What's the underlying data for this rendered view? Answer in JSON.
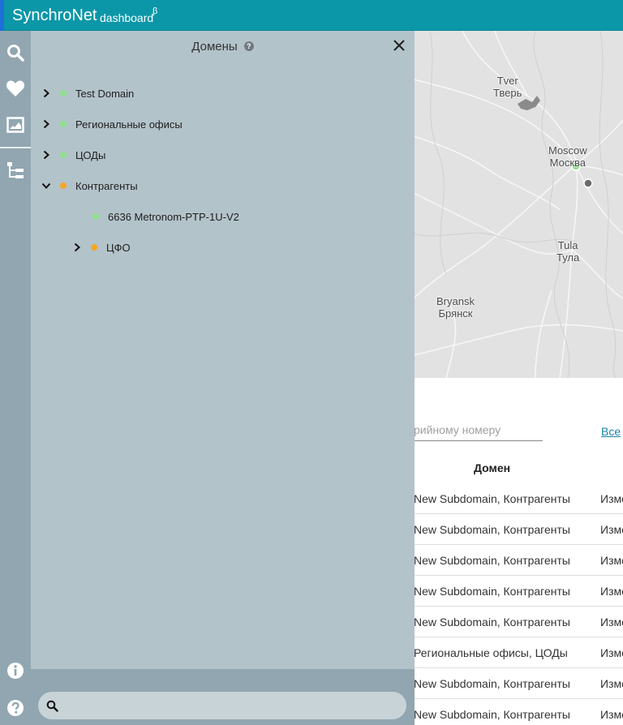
{
  "header": {
    "brand": "SynchroNet",
    "subtitle": "dashboard",
    "beta": "β"
  },
  "sidebar": {
    "icons": [
      "search-icon",
      "heart-icon",
      "map-frame-icon",
      "hierarchy-icon",
      "info-icon",
      "help-icon"
    ]
  },
  "map": {
    "cities": [
      {
        "en": "Tver",
        "ru": "Тверь"
      },
      {
        "en": "Moscow",
        "ru": "Москва"
      },
      {
        "en": "Tula",
        "ru": "Тула"
      },
      {
        "en": "Bryansk",
        "ru": "Брянск"
      }
    ]
  },
  "content": {
    "search_placeholder": "рийному номеру",
    "all_link": "Все",
    "column_domain": "Домен",
    "rows": [
      {
        "domain": "New Subdomain, Контрагенты",
        "action": "Изме"
      },
      {
        "domain": "New Subdomain, Контрагенты",
        "action": "Изме"
      },
      {
        "domain": "New Subdomain, Контрагенты",
        "action": "Изме"
      },
      {
        "domain": "New Subdomain, Контрагенты",
        "action": "Изме"
      },
      {
        "domain": "New Subdomain, Контрагенты",
        "action": "Изме"
      },
      {
        "domain": "Региональные офисы, ЦОДы",
        "action": "Изме"
      },
      {
        "domain": "New Subdomain, Контрагенты",
        "action": "Изме"
      },
      {
        "domain": "New Subdomain, Контрагенты",
        "action": "Изме"
      }
    ]
  },
  "panel": {
    "title": "Домены",
    "help": "?",
    "tree": [
      {
        "label": "Test Domain",
        "status": "green",
        "expanded": false,
        "level": 0
      },
      {
        "label": "Региональные офисы",
        "status": "green",
        "expanded": false,
        "level": 0
      },
      {
        "label": "ЦОДы",
        "status": "green",
        "expanded": false,
        "level": 0
      },
      {
        "label": "Контрагенты",
        "status": "orange",
        "expanded": true,
        "level": 0
      },
      {
        "label": "6636 Metronom-PTP-1U-V2",
        "status": "green",
        "expanded": null,
        "level": 1
      },
      {
        "label": "ЦФО",
        "status": "orange",
        "expanded": false,
        "level": 1
      }
    ],
    "search_value": ""
  },
  "colors": {
    "header": "#0b97a8",
    "sidebar": "#91a6b0",
    "panel": "#b3c3ca",
    "status_green": "#8ee08c",
    "status_orange": "#f5a623"
  }
}
